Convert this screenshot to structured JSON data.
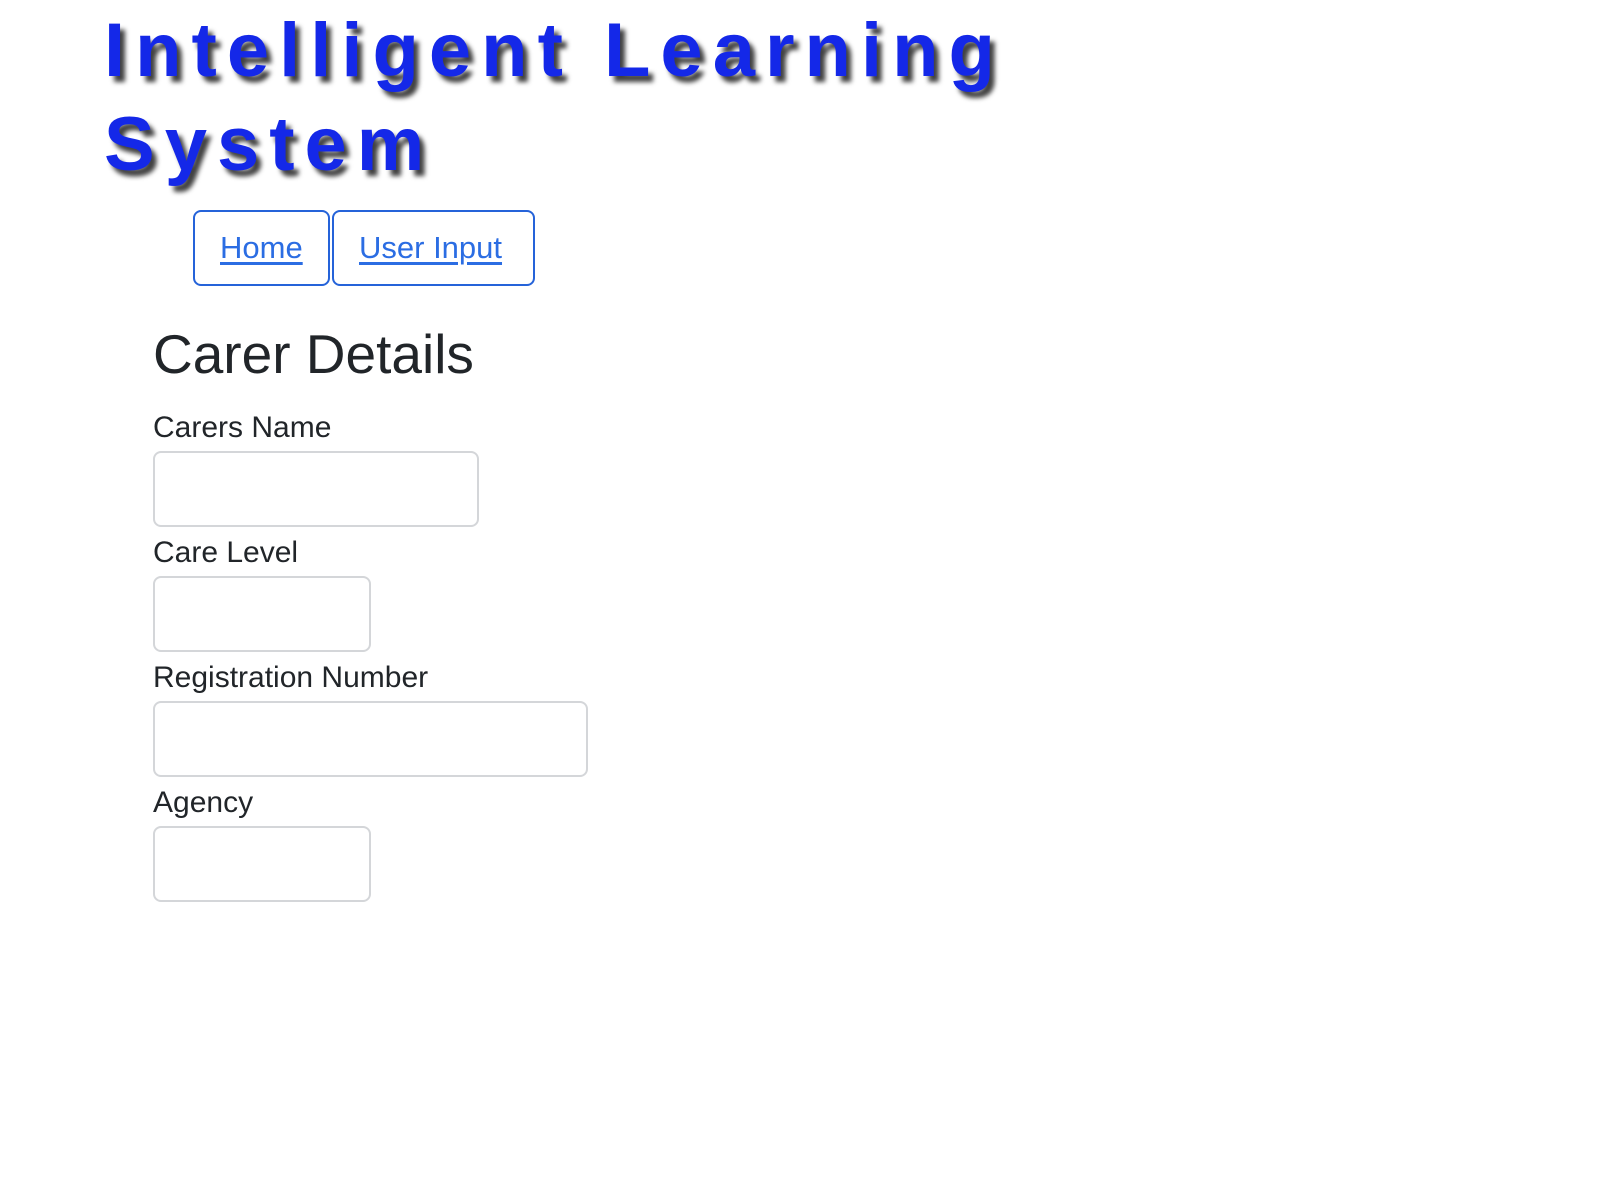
{
  "header": {
    "title": "Intelligent Learning System",
    "title_color": "#1428e8"
  },
  "nav": {
    "items": [
      {
        "label": "Home"
      },
      {
        "label": "User Input"
      }
    ],
    "link_color": "#2b6de3"
  },
  "form": {
    "heading": "Carer Details",
    "fields": [
      {
        "label": "Carers Name",
        "value": "",
        "placeholder": ""
      },
      {
        "label": "Care Level",
        "value": "",
        "placeholder": ""
      },
      {
        "label": "Registration Number",
        "value": "",
        "placeholder": ""
      },
      {
        "label": "Agency",
        "value": "",
        "placeholder": ""
      }
    ]
  }
}
